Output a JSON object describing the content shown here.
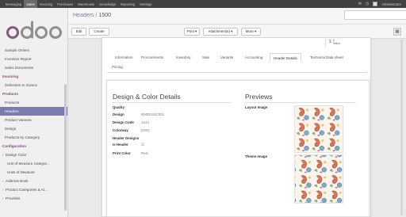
{
  "topbar": {
    "menu": [
      "Messaging",
      "Sales",
      "Invoicing",
      "Purchases",
      "Warehouse",
      "Knowledge",
      "Reporting",
      "Settings"
    ],
    "active_index": 1,
    "user": "Administrator"
  },
  "logo": {
    "text": "odoo"
  },
  "sidebar": {
    "items": [
      {
        "label": "Sample Orders",
        "kind": "item"
      },
      {
        "label": "Incentive Report",
        "kind": "item"
      },
      {
        "label": "Sales Documents",
        "kind": "item"
      },
      {
        "label": "Invoicing",
        "kind": "section"
      },
      {
        "label": "Deliveries to Invoice",
        "kind": "item"
      },
      {
        "label": "Products",
        "kind": "section"
      },
      {
        "label": "Products",
        "kind": "item"
      },
      {
        "label": "Headers",
        "kind": "item",
        "active": true
      },
      {
        "label": "Product Variants",
        "kind": "item"
      },
      {
        "label": "Design",
        "kind": "item"
      },
      {
        "label": "Products by Category",
        "kind": "item"
      },
      {
        "label": "Configuration",
        "kind": "section"
      },
      {
        "label": "Design Color",
        "kind": "tree"
      },
      {
        "label": "Unit of Measure Categor...",
        "kind": "sub2"
      },
      {
        "label": "Units of Measure",
        "kind": "sub2"
      },
      {
        "label": "Address Book",
        "kind": "tree"
      },
      {
        "label": "Product Categories & At...",
        "kind": "tree"
      },
      {
        "label": "Pricelists",
        "kind": "tree"
      }
    ]
  },
  "header": {
    "breadcrumb_parent": "Headers",
    "breadcrumb_sep": "/",
    "breadcrumb_current": "1500"
  },
  "toolbar": {
    "edit": "Edit",
    "create": "Create",
    "print": "Print ▾",
    "attachments": "Attachment(s) ▾",
    "more": "More ▾"
  },
  "smart_button": {
    "count": "0",
    "label": "Sales"
  },
  "tabs": [
    {
      "label": "Information"
    },
    {
      "label": "Procurements"
    },
    {
      "label": "Inventory"
    },
    {
      "label": "Sale"
    },
    {
      "label": "Variants"
    },
    {
      "label": "Accounting"
    },
    {
      "label": "Header Details",
      "active": true
    },
    {
      "label": "Technical Data sheet"
    },
    {
      "label": "Pricing"
    }
  ],
  "design_section": {
    "title": "Design & Color Details",
    "fields": [
      {
        "label": "Quality",
        "value": ""
      },
      {
        "label": "Design",
        "value": "R00D243C001"
      },
      {
        "label": "Design Code",
        "value": "1243"
      },
      {
        "label": "Colorway",
        "value": "C001"
      },
      {
        "label": "Header Designs",
        "value": ""
      },
      {
        "label": "Is Header",
        "value": "☑"
      },
      {
        "label": "Print Color",
        "value": "Red"
      }
    ]
  },
  "previews": {
    "title": "Previews",
    "layout_label": "Layout Image",
    "theme_label": "Theme Image"
  },
  "colors": {
    "brand": "#7c7bad",
    "logo_purple": "#875a7b",
    "logo_grey": "#8f8f8f",
    "topbar": "#414141",
    "section_label": "#7c4f77"
  }
}
